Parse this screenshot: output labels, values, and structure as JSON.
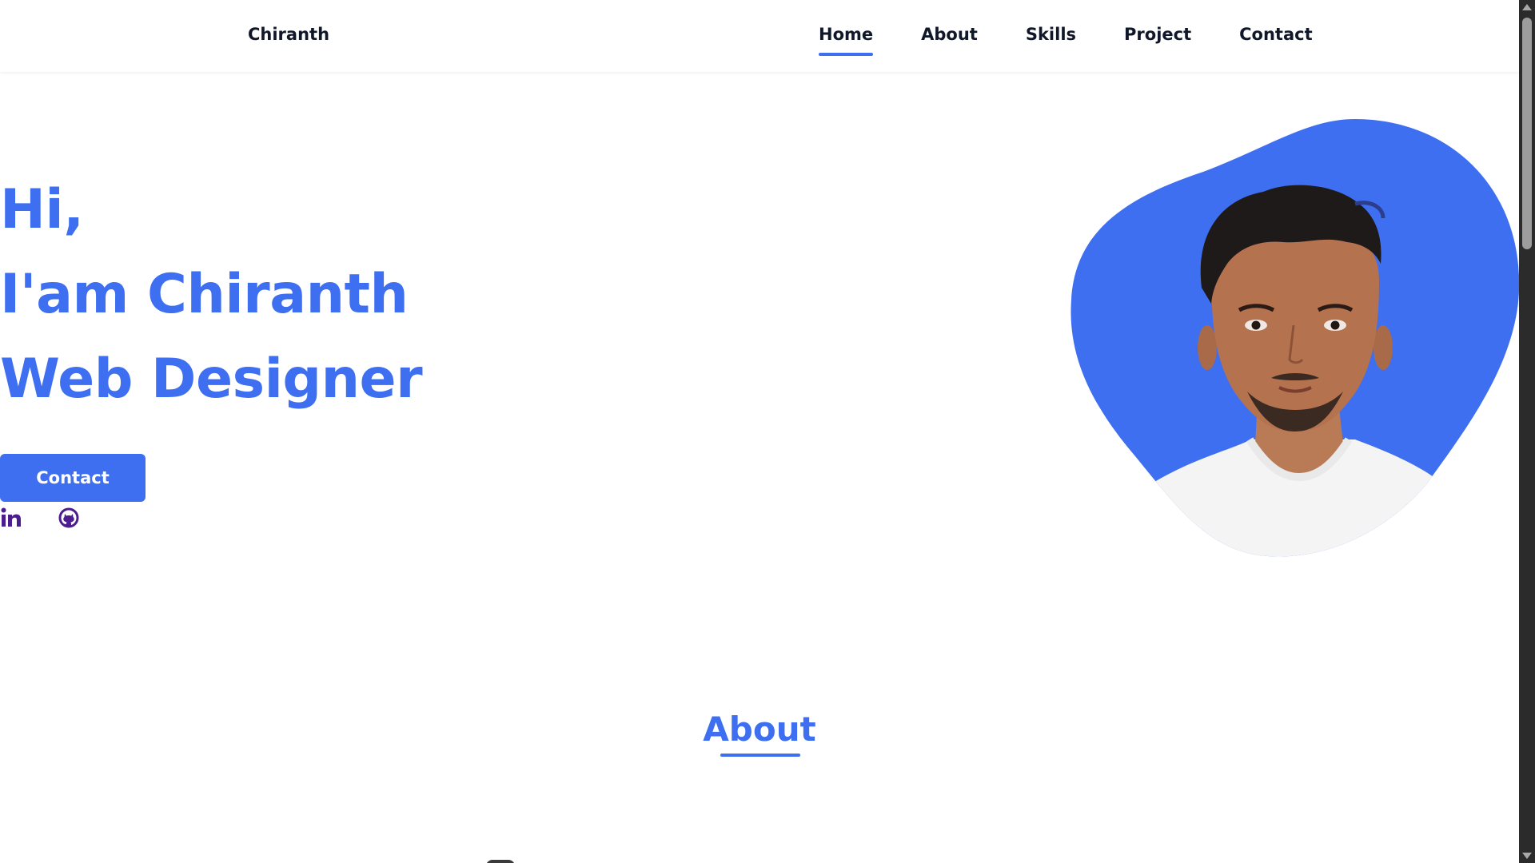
{
  "header": {
    "logo": "Chiranth",
    "nav": [
      {
        "label": "Home",
        "active": true
      },
      {
        "label": "About",
        "active": false
      },
      {
        "label": "Skills",
        "active": false
      },
      {
        "label": "Project",
        "active": false
      },
      {
        "label": "Contact",
        "active": false
      }
    ]
  },
  "hero": {
    "line1": "Hi,",
    "line2": "I'am Chiranth",
    "line3": "Web Designer",
    "button_label": "Contact",
    "social_icons": [
      "linkedin-icon",
      "github-icon"
    ]
  },
  "about": {
    "title": "About"
  },
  "colors": {
    "accent": "#3e6ff0",
    "text_dark": "#0f1729",
    "social": "#4b1d8f",
    "background": "#ffffff"
  }
}
